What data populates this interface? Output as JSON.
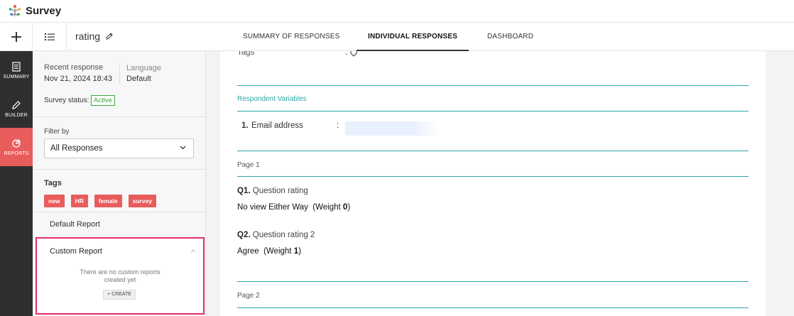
{
  "app": {
    "name": "Survey"
  },
  "topbar": {
    "survey_name": "rating",
    "tabs": [
      {
        "label": "SUMMARY OF RESPONSES",
        "active": false
      },
      {
        "label": "INDIVIDUAL RESPONSES",
        "active": true
      },
      {
        "label": "DASHBOARD",
        "active": false
      }
    ]
  },
  "rail": {
    "items": [
      {
        "label": "SUMMARY",
        "icon": "document-icon",
        "active": false
      },
      {
        "label": "BUILDER",
        "icon": "pencil-icon",
        "active": false
      },
      {
        "label": "REPORTS",
        "icon": "pie-chart-icon",
        "active": true
      }
    ]
  },
  "panel": {
    "recent_response_label": "Recent response",
    "recent_response_value": "Nov 21, 2024 18:43",
    "language_label": "Language",
    "language_value": "Default",
    "status_label": "Survey status:",
    "status_value": "Active",
    "filter_label": "Filter by",
    "filter_value": "All Responses",
    "tags_title": "Tags",
    "tags": [
      "new",
      "HR",
      "female",
      "survey"
    ],
    "default_report": "Default Report",
    "custom_report": {
      "title": "Custom Report",
      "empty_line1": "There are no custom reports",
      "empty_line2": "created yet",
      "create_label": "+ CREATE"
    }
  },
  "main": {
    "tags_label": "Tags",
    "tags_separator": ":",
    "respondent_variables_title": "Respondent Variables",
    "email_index": "1.",
    "email_label": "Email address",
    "email_separator": ":",
    "page1_label": "Page 1",
    "q1_num": "Q1.",
    "q1_text": "Question rating",
    "q1_answer": "No view Either Way",
    "q1_weight_prefix": "(Weight ",
    "q1_weight": "0",
    "q1_weight_suffix": ")",
    "q2_num": "Q2.",
    "q2_text": "Question rating 2",
    "q2_answer": "Agree",
    "q2_weight_prefix": "(Weight ",
    "q2_weight": "1",
    "q2_weight_suffix": ")",
    "page2_label": "Page 2"
  },
  "colors": {
    "accent_red": "#e85c5c",
    "teal": "#2aa7a7",
    "highlight_border": "#e32c6b",
    "active_green": "#3aa53a"
  }
}
